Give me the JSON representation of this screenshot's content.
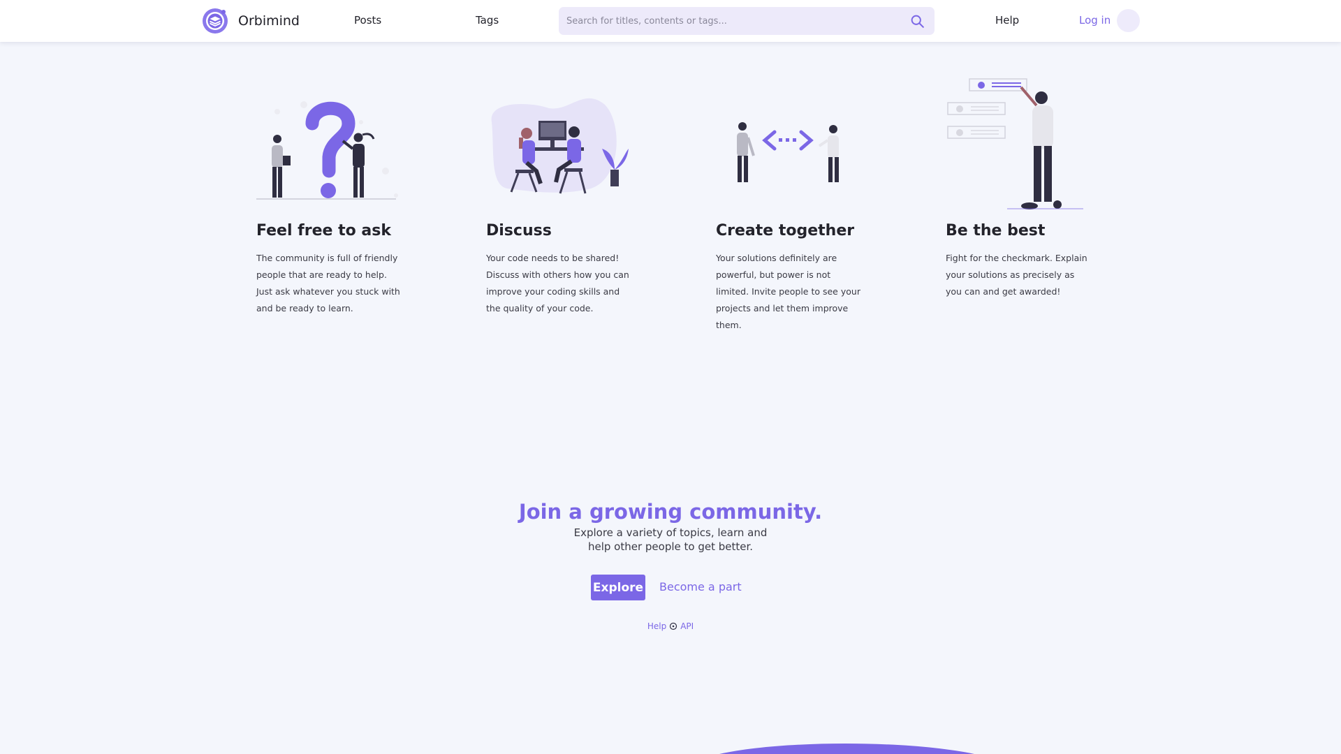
{
  "header": {
    "brand": "Orbimind",
    "nav": {
      "posts": "Posts",
      "tags": "Tags",
      "help": "Help",
      "login": "Log in"
    },
    "search": {
      "placeholder": "Search for titles, contents or tags..."
    }
  },
  "features": [
    {
      "title": "Feel free to ask",
      "text": "The community is full of friendly people that are ready to help. Just ask whatever you stuck with and be ready to learn.",
      "illustration_icon": "question-people-illustration"
    },
    {
      "title": "Discuss",
      "text": "Your code needs to be shared! Discuss with others how you can improve your coding skills and the quality of your code.",
      "illustration_icon": "discuss-desk-illustration"
    },
    {
      "title": "Create together",
      "text": "Your solutions definitely are powerful, but power is not limited. Invite people to see your projects and let them improve them.",
      "illustration_icon": "code-collaboration-illustration"
    },
    {
      "title": "Be the best",
      "text": "Fight for the checkmark. Explain your solutions as precisely as you can and get awarded!",
      "illustration_icon": "standing-person-checklist-illustration"
    }
  ],
  "cta": {
    "title": "Join a growing community.",
    "subtitle": "Explore a variety of topics, learn and help other people to get better.",
    "explore_label": "Explore",
    "become_label": "Become a part"
  },
  "footer": {
    "help": "Help",
    "api": "API"
  },
  "colors": {
    "accent": "#7b67e6",
    "background": "#f4f6fc",
    "search_bg": "#edeafa"
  }
}
